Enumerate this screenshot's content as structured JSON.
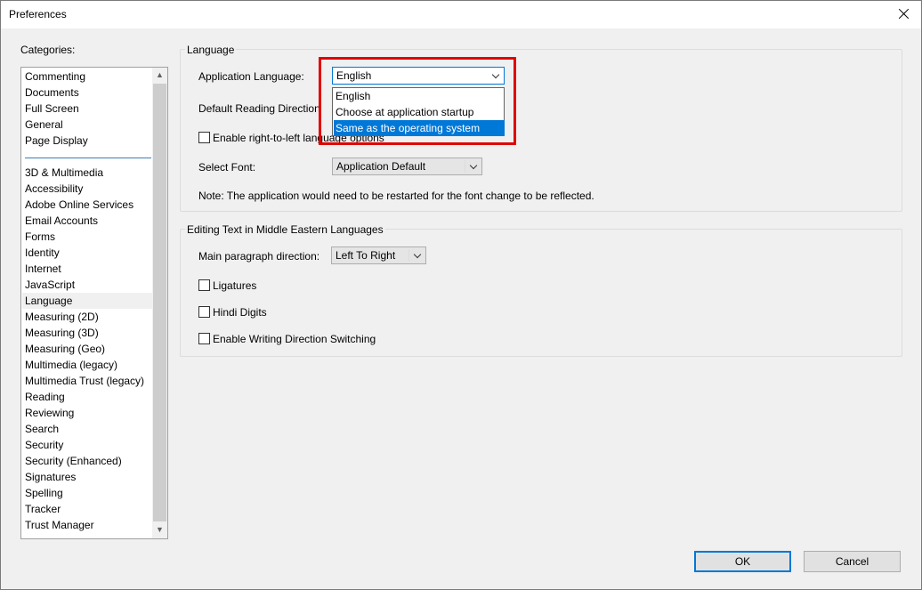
{
  "window": {
    "title": "Preferences"
  },
  "categories": {
    "label": "Categories:",
    "group1": [
      "Commenting",
      "Documents",
      "Full Screen",
      "General",
      "Page Display"
    ],
    "group2": [
      "3D & Multimedia",
      "Accessibility",
      "Adobe Online Services",
      "Email Accounts",
      "Forms",
      "Identity",
      "Internet",
      "JavaScript",
      "Language",
      "Measuring (2D)",
      "Measuring (3D)",
      "Measuring (Geo)",
      "Multimedia (legacy)",
      "Multimedia Trust (legacy)",
      "Reading",
      "Reviewing",
      "Search",
      "Security",
      "Security (Enhanced)",
      "Signatures",
      "Spelling",
      "Tracker",
      "Trust Manager"
    ],
    "selected": "Language"
  },
  "language": {
    "group_title": "Language",
    "app_language_label": "Application Language:",
    "app_language_value": "English",
    "app_language_options": [
      "English",
      "Choose at application startup",
      "Same as the operating system"
    ],
    "app_language_highlighted": "Same as the operating system",
    "reading_direction_label": "Default Reading Direction",
    "rtl_options_label": "Enable right-to-left language options",
    "select_font_label": "Select Font:",
    "select_font_value": "Application Default",
    "note": "Note: The application would need to be restarted for the font change to be reflected."
  },
  "middle_eastern": {
    "group_title": "Editing Text in Middle Eastern Languages",
    "paragraph_direction_label": "Main paragraph direction:",
    "paragraph_direction_value": "Left To Right",
    "ligatures_label": "Ligatures",
    "hindi_digits_label": "Hindi Digits",
    "writing_direction_label": "Enable Writing Direction Switching"
  },
  "buttons": {
    "ok": "OK",
    "cancel": "Cancel"
  },
  "colors": {
    "accent": "#0078d7",
    "annotation": "#e00000"
  }
}
